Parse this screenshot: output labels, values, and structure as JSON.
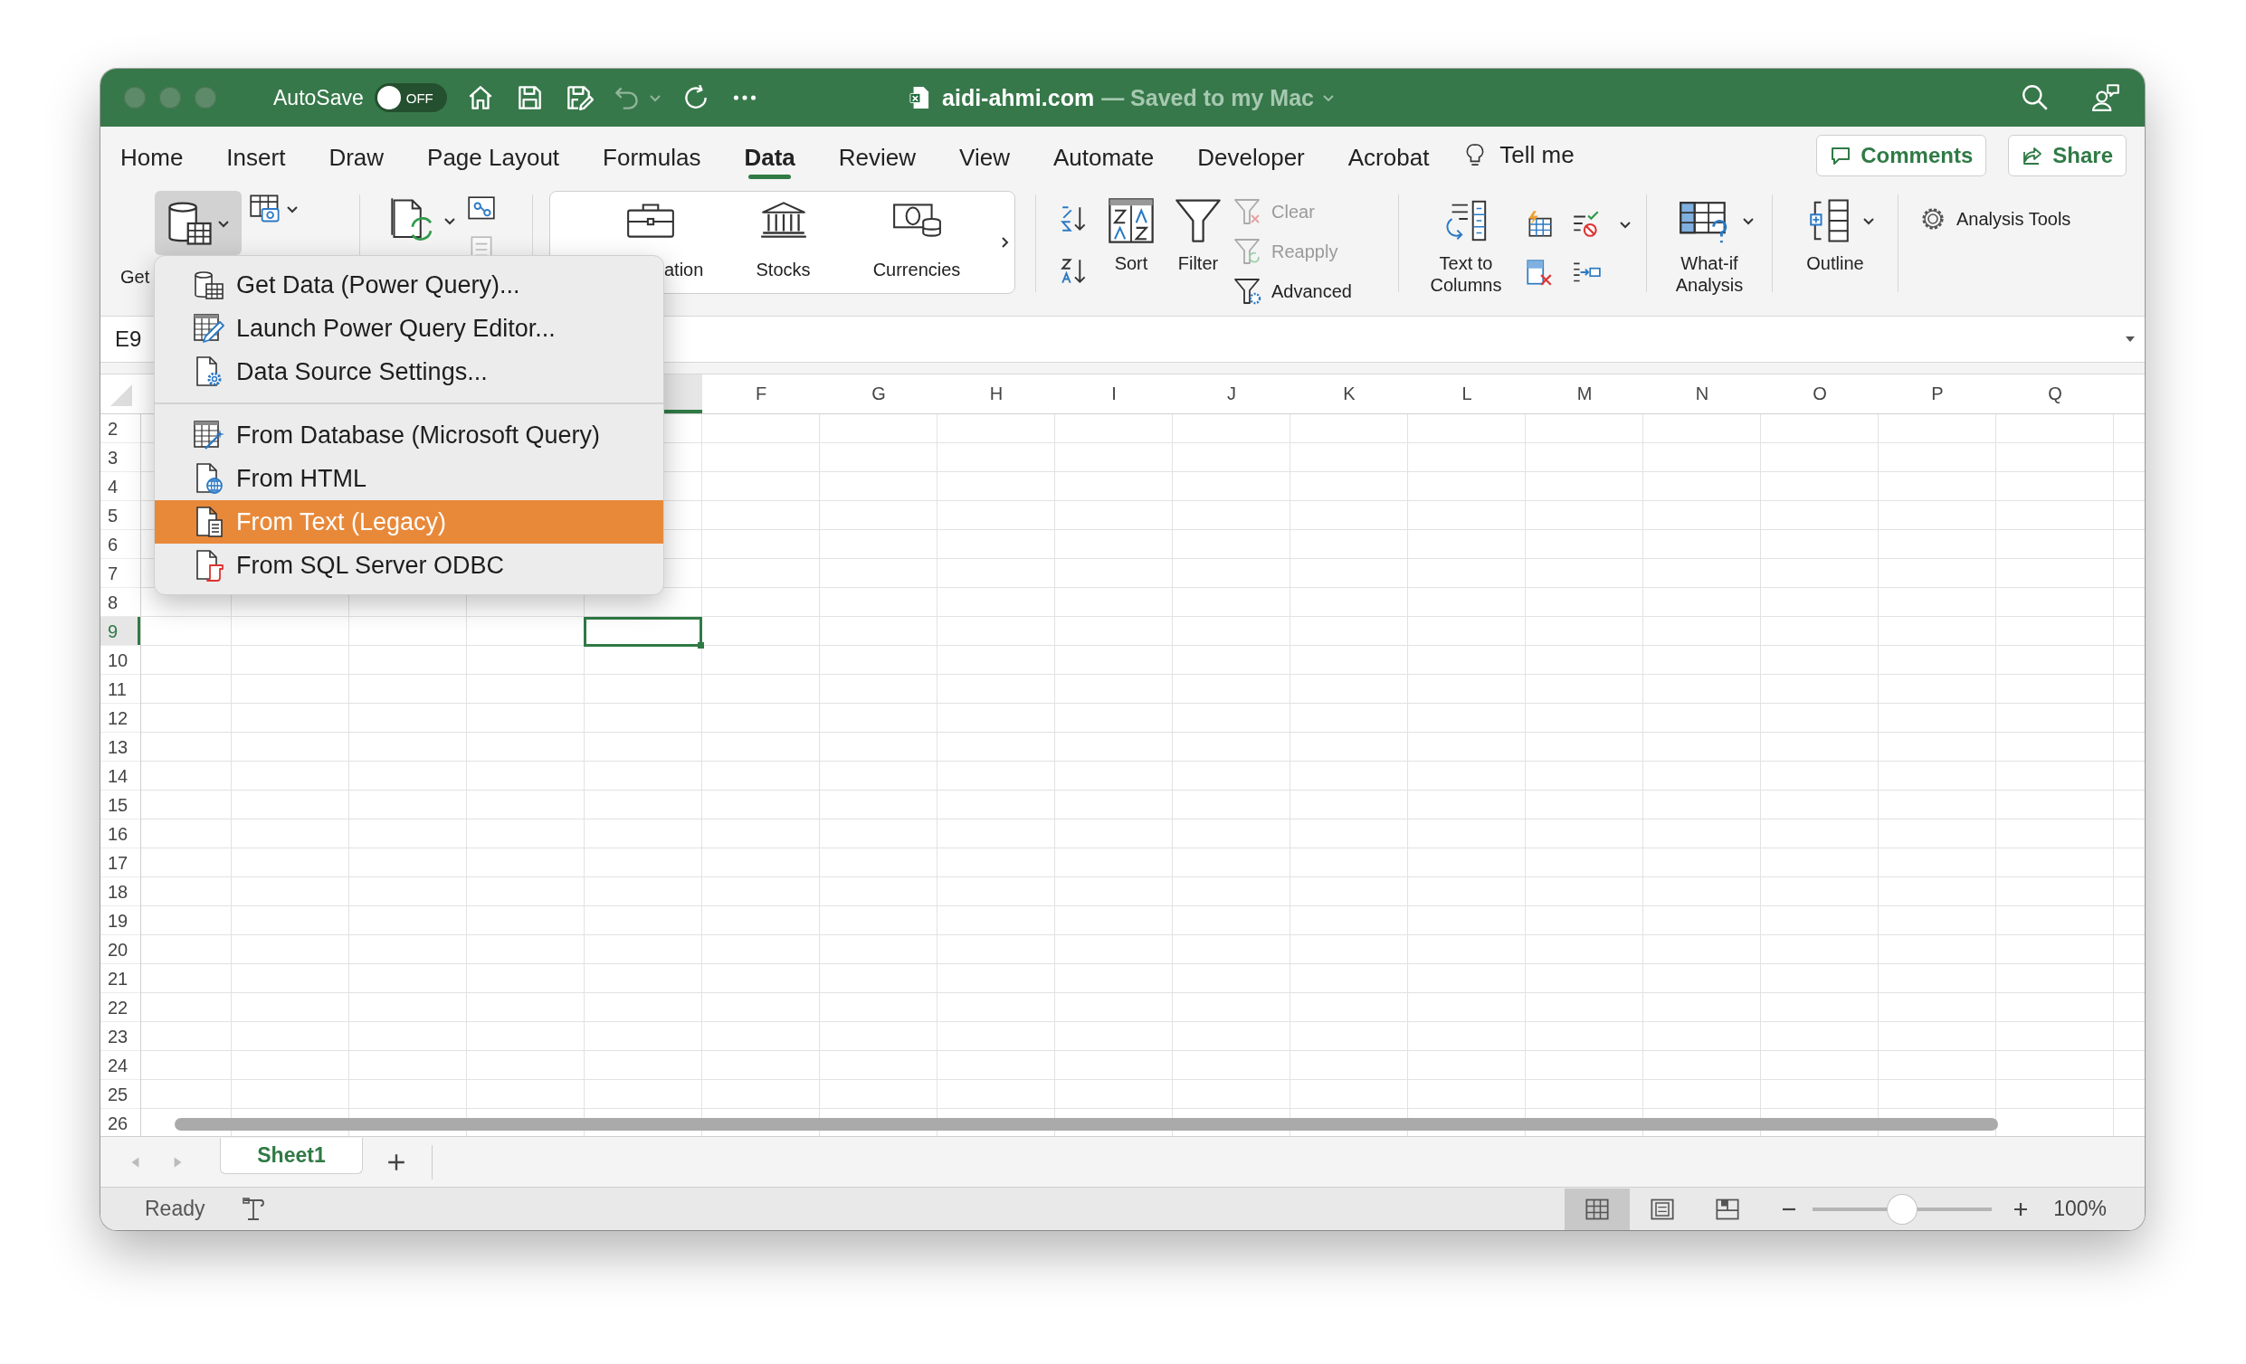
{
  "window": {
    "title": "aidi-ahmi.com",
    "status": "— Saved to my Mac"
  },
  "quick_access": {
    "autosave_label": "AutoSave",
    "autosave_toggle": {
      "label": "OFF",
      "on": false
    },
    "undo": {
      "disabled": true
    }
  },
  "tabs": [
    {
      "label": "Home",
      "selected": false
    },
    {
      "label": "Insert",
      "selected": false
    },
    {
      "label": "Draw",
      "selected": false
    },
    {
      "label": "Page Layout",
      "selected": false
    },
    {
      "label": "Formulas",
      "selected": false
    },
    {
      "label": "Data",
      "selected": true
    },
    {
      "label": "Review",
      "selected": false
    },
    {
      "label": "View",
      "selected": false
    },
    {
      "label": "Automate",
      "selected": false
    },
    {
      "label": "Developer",
      "selected": false
    },
    {
      "label": "Acrobat",
      "selected": false
    }
  ],
  "tell_me": {
    "label": "Tell me"
  },
  "actions": [
    {
      "label": "Comments",
      "kind": "comments"
    },
    {
      "label": "Share",
      "kind": "share"
    }
  ],
  "ribbon": {
    "get_data": {
      "label": "Get",
      "pressed": true
    },
    "data_types": [
      {
        "label": "ation",
        "kind": "briefcase"
      },
      {
        "label": "Stocks",
        "kind": "bank"
      },
      {
        "label": "Currencies",
        "kind": "currency"
      }
    ],
    "sort": {
      "label": "Sort"
    },
    "filter": {
      "label": "Filter"
    },
    "filter_actions": [
      {
        "label": "Clear",
        "kind": "clear",
        "disabled": true
      },
      {
        "label": "Reapply",
        "kind": "reapply",
        "disabled": true
      },
      {
        "label": "Advanced",
        "kind": "advanced",
        "disabled": false
      }
    ],
    "text_to_columns": {
      "label": "Text to Columns"
    },
    "what_if": {
      "label": "What-if Analysis"
    },
    "outline": {
      "label": "Outline"
    },
    "analysis_tools": {
      "label": "Analysis Tools"
    }
  },
  "name_box": {
    "value": "E9"
  },
  "sheet": {
    "columns": [
      "F",
      "G",
      "H",
      "I",
      "J",
      "K",
      "L",
      "M",
      "N",
      "O",
      "P",
      "Q"
    ],
    "rows": [
      {
        "label": "2",
        "selected": false
      },
      {
        "label": "3",
        "selected": false
      },
      {
        "label": "4",
        "selected": false
      },
      {
        "label": "5",
        "selected": false
      },
      {
        "label": "6",
        "selected": false
      },
      {
        "label": "7",
        "selected": false
      },
      {
        "label": "8",
        "selected": false
      },
      {
        "label": "9",
        "selected": true
      },
      {
        "label": "10",
        "selected": false
      },
      {
        "label": "11",
        "selected": false
      },
      {
        "label": "12",
        "selected": false
      },
      {
        "label": "13",
        "selected": false
      },
      {
        "label": "14",
        "selected": false
      },
      {
        "label": "15",
        "selected": false
      },
      {
        "label": "16",
        "selected": false
      },
      {
        "label": "17",
        "selected": false
      },
      {
        "label": "18",
        "selected": false
      },
      {
        "label": "19",
        "selected": false
      },
      {
        "label": "20",
        "selected": false
      },
      {
        "label": "21",
        "selected": false
      },
      {
        "label": "22",
        "selected": false
      },
      {
        "label": "23",
        "selected": false
      },
      {
        "label": "24",
        "selected": false
      },
      {
        "label": "25",
        "selected": false
      },
      {
        "label": "26",
        "selected": false
      }
    ]
  },
  "menu": {
    "groups": [
      {
        "items": [
          {
            "label": "Get Data (Power Query)...",
            "kind": "get-data",
            "selected": false
          },
          {
            "label": "Launch Power Query Editor...",
            "kind": "editor",
            "selected": false
          },
          {
            "label": "Data Source Settings...",
            "kind": "settings",
            "selected": false
          }
        ]
      },
      {
        "items": [
          {
            "label": "From Database (Microsoft Query)",
            "kind": "database",
            "selected": false
          },
          {
            "label": "From HTML",
            "kind": "html",
            "selected": false
          },
          {
            "label": "From Text (Legacy)",
            "kind": "text",
            "selected": true
          },
          {
            "label": "From SQL Server ODBC",
            "kind": "sql",
            "selected": false
          }
        ]
      }
    ]
  },
  "sheet_tabs": [
    {
      "label": "Sheet1",
      "selected": true
    }
  ],
  "status_bar": {
    "status": "Ready",
    "views": [
      {
        "kind": "normal",
        "selected": true
      },
      {
        "kind": "page-layout",
        "selected": false
      },
      {
        "kind": "page-break",
        "selected": false
      }
    ],
    "zoom": {
      "level": 0.5,
      "reading": "100%"
    }
  }
}
